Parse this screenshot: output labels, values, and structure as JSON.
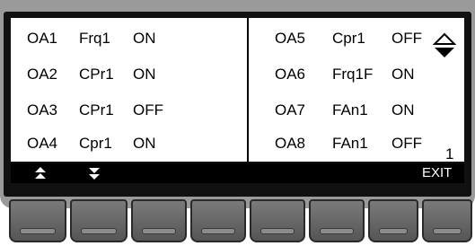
{
  "outputs_left": [
    {
      "id": "OA1",
      "function": "Frq1",
      "state": "ON"
    },
    {
      "id": "OA2",
      "function": "CPr1",
      "state": "ON"
    },
    {
      "id": "OA3",
      "function": "CPr1",
      "state": "OFF"
    },
    {
      "id": "OA4",
      "function": "Cpr1",
      "state": "ON"
    }
  ],
  "outputs_right": [
    {
      "id": "OA5",
      "function": "Cpr1",
      "state": "OFF"
    },
    {
      "id": "OA6",
      "function": "Frq1F",
      "state": "ON"
    },
    {
      "id": "OA7",
      "function": "FAn1",
      "state": "ON"
    },
    {
      "id": "OA8",
      "function": "FAn1",
      "state": "OFF"
    }
  ],
  "page_number": "1",
  "softkeys": {
    "key1_icon": "double-up-arrow-icon",
    "key2_icon": "double-down-arrow-icon",
    "exit_label": "EXIT"
  },
  "scroll_indicator_icon": "up-down-scroll-icon",
  "colors": {
    "bezel": "#9a9a9a",
    "screen_border": "#111111",
    "screen_bg": "#ffffff",
    "softkey_bar": "#000000",
    "hardware_button": "#666666"
  }
}
